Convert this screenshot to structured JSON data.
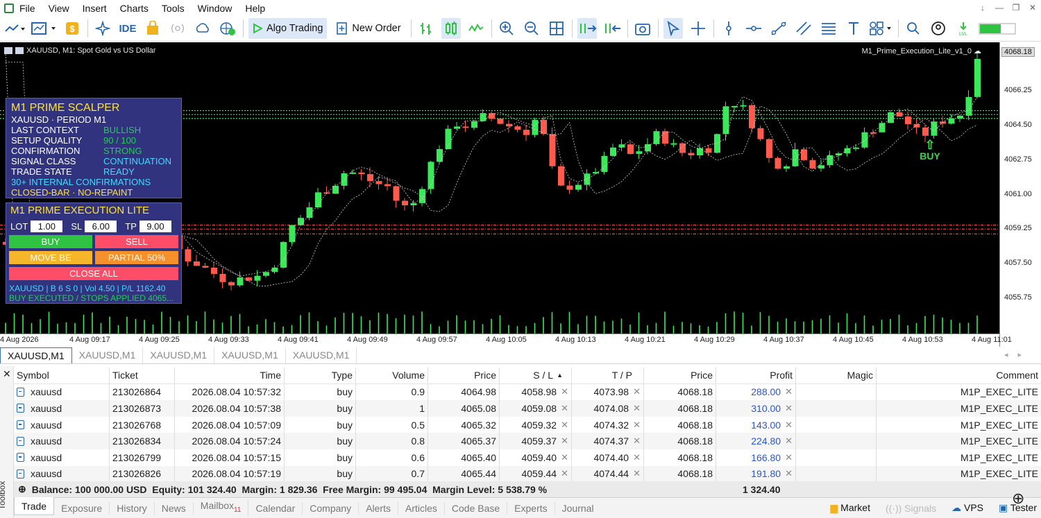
{
  "app_menu": [
    "File",
    "View",
    "Insert",
    "Charts",
    "Tools",
    "Window",
    "Help"
  ],
  "window_controls": [
    "↓",
    "—",
    "❐",
    "✕"
  ],
  "toolbar": {
    "algo_trading": "Algo Trading",
    "new_order": "New Order",
    "ide": "IDE"
  },
  "chart": {
    "title": "XAUUSD, M1:  Spot Gold vs US Dollar",
    "ea_label": "M1_Prime_Execution_Lite_v1_0",
    "current_price": "4068.18",
    "price_labels": [
      "4066.25",
      "4064.50",
      "4062.75",
      "4061.00",
      "4059.25",
      "4057.50",
      "4055.75"
    ],
    "time_labels": [
      "4 Aug 2026",
      "4 Aug 09:17",
      "4 Aug 09:25",
      "4 Aug 09:33",
      "4 Aug 09:41",
      "4 Aug 09:49",
      "4 Aug 09:57",
      "4 Aug 10:05",
      "4 Aug 10:13",
      "4 Aug 10:21",
      "4 Aug 10:29",
      "4 Aug 10:37",
      "4 Aug 10:45",
      "4 Aug 10:53",
      "4 Aug 11:01"
    ],
    "buy_marker": "BUY",
    "buy_arrow": "⇧"
  },
  "scalper_panel": {
    "title": "M1 PRIME SCALPER",
    "subtitle": "XAUUSD · PERIOD M1",
    "rows": [
      {
        "k": "LAST CONTEXT",
        "v": "BULLISH"
      },
      {
        "k": "SETUP QUALITY",
        "v": "90 / 100"
      },
      {
        "k": "CONFIRMATION",
        "v": "STRONG"
      },
      {
        "k": "SIGNAL CLASS",
        "v": "CONTINUATION"
      },
      {
        "k": "TRADE STATE",
        "v": "READY"
      }
    ],
    "line1": "30+ INTERNAL CONFIRMATIONS",
    "line2": "CLOSED-BAR · NO-REPAINT"
  },
  "exec_panel": {
    "title": "M1 PRIME EXECUTION LITE",
    "lot_label": "LOT",
    "lot": "1.00",
    "sl_label": "SL",
    "sl": "6.00",
    "tp_label": "TP",
    "tp": "9.00",
    "buy": "BUY",
    "sell": "SELL",
    "move_be": "MOVE BE",
    "partial": "PARTIAL 50%",
    "close_all": "CLOSE ALL",
    "status1": "XAUUSD | B 6 S 0 | Vol 4.50 | P/L 1162.40",
    "status2": "BUY EXECUTED / STOPS APPLIED 4065..."
  },
  "chart_tabs": [
    "XAUUSD,M1",
    "XAUUSD,M1",
    "XAUUSD,M1",
    "XAUUSD,M1",
    "XAUUSD,M1"
  ],
  "trade_table": {
    "headers": [
      "Symbol",
      "Ticket",
      "Time",
      "Type",
      "Volume",
      "Price",
      "S / L",
      "T / P",
      "Price",
      "Profit",
      "Magic",
      "Comment"
    ],
    "sort_indicator": "▲",
    "rows": [
      {
        "symbol": "xauusd",
        "ticket": "213026864",
        "time": "2026.08.04 10:57:32",
        "type": "buy",
        "volume": "0.9",
        "price": "4064.98",
        "sl": "4058.98",
        "tp": "4073.98",
        "cur": "4068.18",
        "profit": "288.00",
        "magic": "",
        "comment": "M1P_EXEC_LITE"
      },
      {
        "symbol": "xauusd",
        "ticket": "213026873",
        "time": "2026.08.04 10:57:38",
        "type": "buy",
        "volume": "1",
        "price": "4065.08",
        "sl": "4059.08",
        "tp": "4074.08",
        "cur": "4068.18",
        "profit": "310.00",
        "magic": "",
        "comment": "M1P_EXEC_LITE"
      },
      {
        "symbol": "xauusd",
        "ticket": "213026768",
        "time": "2026.08.04 10:57:09",
        "type": "buy",
        "volume": "0.5",
        "price": "4065.32",
        "sl": "4059.32",
        "tp": "4074.32",
        "cur": "4068.18",
        "profit": "143.00",
        "magic": "",
        "comment": "M1P_EXEC_LITE"
      },
      {
        "symbol": "xauusd",
        "ticket": "213026834",
        "time": "2026.08.04 10:57:24",
        "type": "buy",
        "volume": "0.8",
        "price": "4065.37",
        "sl": "4059.37",
        "tp": "4074.37",
        "cur": "4068.18",
        "profit": "224.80",
        "magic": "",
        "comment": "M1P_EXEC_LITE"
      },
      {
        "symbol": "xauusd",
        "ticket": "213026799",
        "time": "2026.08.04 10:57:15",
        "type": "buy",
        "volume": "0.6",
        "price": "4065.40",
        "sl": "4059.40",
        "tp": "4074.40",
        "cur": "4068.18",
        "profit": "166.80",
        "magic": "",
        "comment": "M1P_EXEC_LITE"
      },
      {
        "symbol": "xauusd",
        "ticket": "213026826",
        "time": "2026.08.04 10:57:19",
        "type": "buy",
        "volume": "0.7",
        "price": "4065.44",
        "sl": "4059.44",
        "tp": "4074.44",
        "cur": "4068.18",
        "profit": "191.80",
        "magic": "",
        "comment": "M1P_EXEC_LITE"
      }
    ]
  },
  "balance": {
    "text": "Balance: 100 000.00 USD  Equity: 101 324.40  Margin: 1 829.36  Free Margin: 99 495.04  Margin Level: 5 538.79 %",
    "pl": "1 324.40"
  },
  "bottom_tabs": [
    "Trade",
    "Exposure",
    "History",
    "News",
    "Mailbox",
    "Calendar",
    "Company",
    "Alerts",
    "Articles",
    "Code Base",
    "Experts",
    "Journal"
  ],
  "mailbox_count": "11",
  "status_right": {
    "market": "Market",
    "signals": "Signals",
    "vps": "VPS",
    "tester": "Tester"
  },
  "toolbox_label": "Toolbox",
  "colors": {
    "bull": "#3be85a",
    "bear": "#ff5a4e",
    "panel": "#31337f",
    "accent": "#ffe233"
  }
}
